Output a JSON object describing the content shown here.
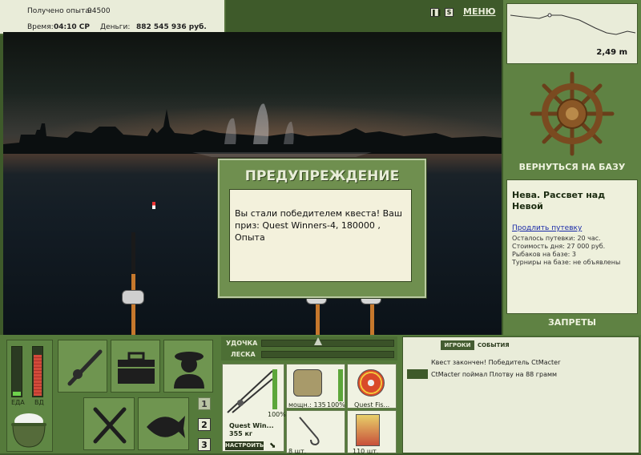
{
  "info": {
    "xp_label": "Получено опыта:",
    "xp_value": "94500",
    "time_label": "Время:",
    "time_value": "04:10 СР",
    "money_label": "Деньги:",
    "money_value": "882 545 936 руб."
  },
  "top_controls": {
    "pause_icon": "pause-icon",
    "sound_icon": "speaker-icon",
    "menu_label": "МЕНЮ"
  },
  "depth": {
    "value": "2,49 m"
  },
  "base": {
    "return_label": "ВЕРНУТЬСЯ НА БАЗУ",
    "location_name": "Нева. Рассвет над Невой",
    "extend_link": "Продлить путевку",
    "remaining": "Осталось путевки: 20 час.",
    "day_cost": "Стоимость дня: 27 000 руб.",
    "fishers": "Рыбаков на базе: 3",
    "tournaments": "Турниры на базе: не объявлены",
    "bans_label": "ЗАПРЕТЫ"
  },
  "dialog": {
    "title": "ПРЕДУПРЕЖДЕНИЕ",
    "message": "Вы стали победителем квеста! Ваш приз: Quest Winners-4, 180000 , Опыта"
  },
  "needs": {
    "food_label": "ЕДА",
    "water_label": "ВД",
    "food_level": 0.08,
    "water_level": 0.85
  },
  "tackle": {
    "rod_label": "УДОЧКА",
    "line_label": "ЛЕСКА",
    "rod_name": "Quest Win...",
    "rod_weight": "355 кг",
    "rod_percent": "100%",
    "reel_label": "мощн.: 135",
    "reel_percent": "100%",
    "line_name": "Quest Fis...",
    "hook_count": "8 шт.",
    "bait_count": "110 шт.",
    "setup_label": "НАСТРОИТЬ"
  },
  "slots": [
    "1",
    "2",
    "3"
  ],
  "chat": {
    "tab_players": "ИГРОКИ",
    "tab_events": "СОБЫТИЯ",
    "messages": [
      "Квест закончен! Победитель CtMacter",
      "CtMacter поймал Плотву на 88 грамм"
    ]
  }
}
